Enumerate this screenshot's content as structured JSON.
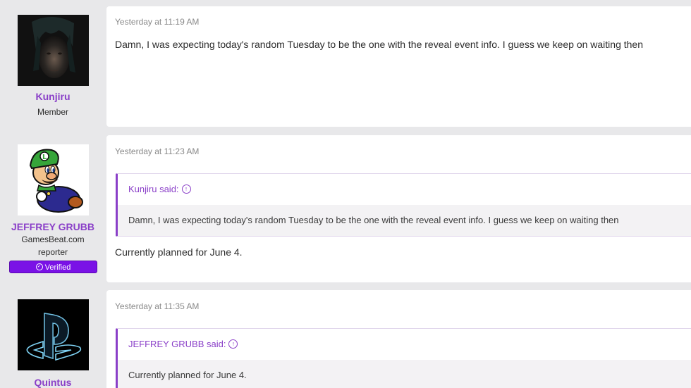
{
  "posts": [
    {
      "user": {
        "name": "Kunjiru",
        "title": "Member"
      },
      "timestamp": "Yesterday at 11:19 AM",
      "text": "Damn, I was expecting today's random Tuesday to be the one with the reveal event info. I guess we keep on waiting then"
    },
    {
      "user": {
        "name": "JEFFREY GRUBB",
        "title_line1": "GamesBeat.com",
        "title_line2": "reporter",
        "badge": "Verified"
      },
      "timestamp": "Yesterday at 11:23 AM",
      "quote": {
        "author": "Kunjiru said:",
        "text": "Damn, I was expecting today's random Tuesday to be the one with the reveal event info. I guess we keep on waiting then"
      },
      "text": "Currently planned for June 4."
    },
    {
      "user": {
        "name": "Quintus"
      },
      "timestamp": "Yesterday at 11:35 AM",
      "quote": {
        "author": "JEFFREY GRUBB said:",
        "text": "Currently planned for June 4."
      }
    }
  ],
  "icons": {
    "quote_jump": "arrow-up-circle-icon",
    "verified": "check-circle-icon"
  },
  "colors": {
    "accent": "#8a3fc8",
    "verified_bg": "#7a12e6",
    "page_bg": "#e8e8ea"
  }
}
